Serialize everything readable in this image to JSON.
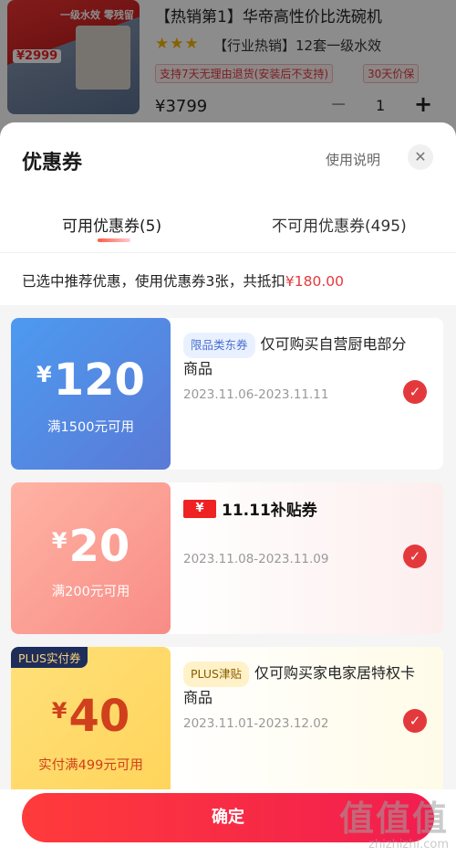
{
  "product": {
    "image_texts": [
      "一级水效 零残留",
      "¥2999"
    ],
    "title": "【热销第1】华帝高性价比洗碗机",
    "stars": "★★★",
    "hot_tag": "【行业热销】12套一级水效",
    "badges": [
      "支持7天无理由退货(安装后不支持)",
      "30天价保"
    ],
    "price": "¥3799",
    "qty_minus": "−",
    "qty": "1",
    "qty_plus": "+"
  },
  "sheet": {
    "title": "优惠券",
    "help": "使用说明",
    "close": "✕",
    "tabs": [
      {
        "label": "可用优惠券(5)",
        "active": true
      },
      {
        "label": "不可用优惠券(495)",
        "active": false
      }
    ],
    "summary_prefix": "已选中推荐优惠，使用优惠券3张，共抵扣",
    "summary_amount": "¥180.00"
  },
  "coupons": [
    {
      "yen": "¥",
      "amount": "120",
      "condition": "满1500元可用",
      "tag": "限品类东券",
      "desc_prefix": "仅可购买自营厨电部分商品",
      "date": "2023.11.06-2023.11.11",
      "selected": true,
      "color": "#4d9af0"
    },
    {
      "yen": "¥",
      "amount": "20",
      "condition": "满200元可用",
      "logo_yen": "¥",
      "logo_label": "11.11补贴券",
      "date": "2023.11.08-2023.11.09",
      "selected": true,
      "color": "#f88c86"
    },
    {
      "corner": "PLUS实付券",
      "yen": "¥",
      "amount": "40",
      "condition": "实付满499元可用",
      "tag": "PLUS津贴",
      "desc_prefix": "仅可购买家电家居特权卡商品",
      "date": "2023.11.01-2023.12.02",
      "selected": true,
      "color": "#ffd45a"
    }
  ],
  "footer": {
    "confirm": "确定",
    "watermark_logo": "值值值",
    "watermark_text": "zhizhizhi.com"
  },
  "colors": {
    "accent": "#e4393c",
    "confirm_gradient": [
      "#ff3b3b",
      "#f11d4f"
    ]
  }
}
